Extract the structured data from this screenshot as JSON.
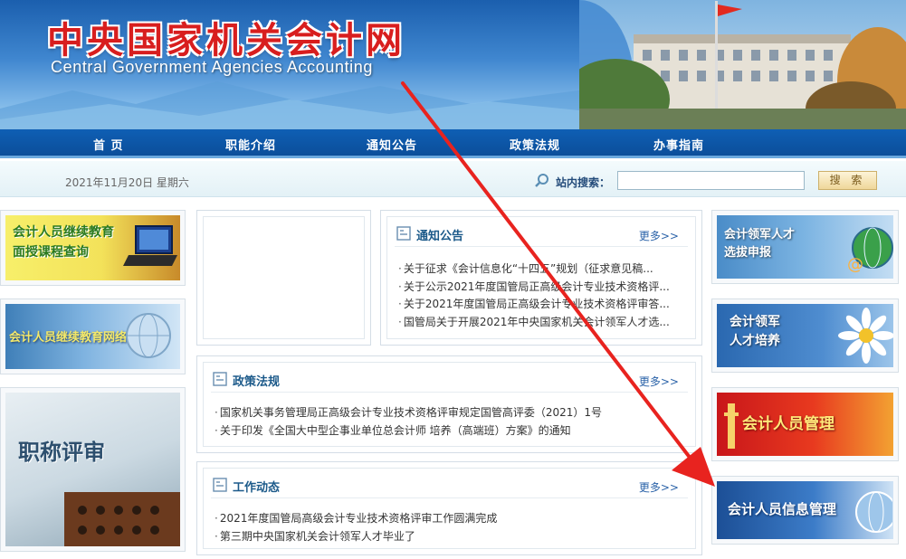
{
  "header": {
    "title_cn": "中央国家机关会计网",
    "title_en": "Central Government Agencies Accounting"
  },
  "nav": {
    "items": [
      "首 页",
      "职能介绍",
      "通知公告",
      "政策法规",
      "办事指南"
    ]
  },
  "toolbar": {
    "date": "2021年11月20日 星期六",
    "search_label": "站内搜索：",
    "search_value": "",
    "search_button": "搜 索"
  },
  "left_banners": [
    {
      "text": "会计人员继续教育\n面授课程查询"
    },
    {
      "text": "会计人员继续教育网络培训"
    },
    {
      "text": "职称评审"
    }
  ],
  "right_banners": [
    {
      "text": "会计领军人才\n选拔申报"
    },
    {
      "text": "会计领军\n人才培养"
    },
    {
      "text": "会计人员管理"
    },
    {
      "text": "会计人员信息管理"
    }
  ],
  "notice": {
    "title": "通知公告",
    "more": "更多>>",
    "items": [
      "关于征求《会计信息化“十四五”规划（征求意见稿...",
      "关于公示2021年度国管局正高级会计专业技术资格评...",
      "关于2021年度国管局正高级会计专业技术资格评审答...",
      "国管局关于开展2021年中央国家机关会计领军人才选..."
    ]
  },
  "policy": {
    "title": "政策法规",
    "more": "更多>>",
    "items": [
      "国家机关事务管理局正高级会计专业技术资格评审规定国管高评委（2021）1号",
      "关于印发《全国大中型企事业单位总会计师 培养（高端班）方案》的通知"
    ]
  },
  "work": {
    "title": "工作动态",
    "more": "更多>>",
    "items": [
      "2021年度国管局高级会计专业技术资格评审工作圆满完成",
      "第三期中央国家机关会计领军人才毕业了"
    ]
  },
  "colors": {
    "nav_bg": "#0b4e9a",
    "title_red": "#d81e1e",
    "arrow_red": "#e8231f",
    "panel_title": "#1c5a8a"
  }
}
